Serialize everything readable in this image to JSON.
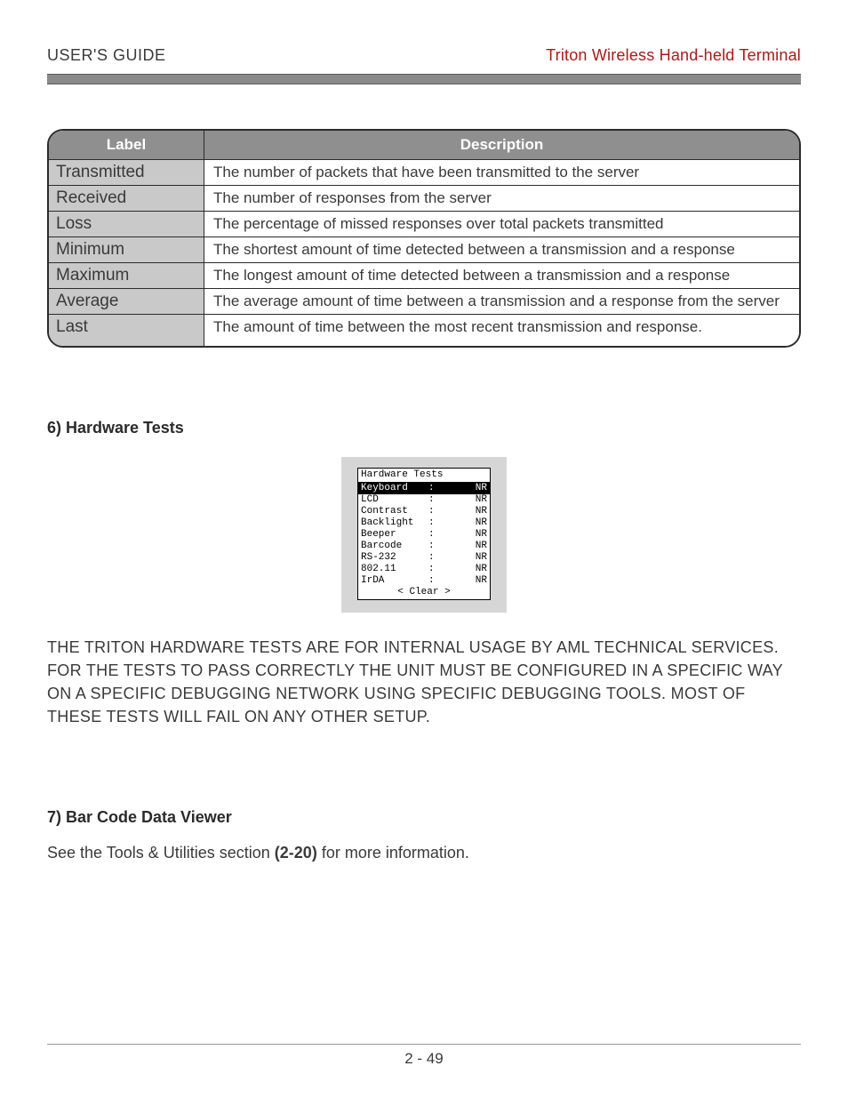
{
  "header": {
    "left": "USER'S GUIDE",
    "right": "Triton Wireless Hand-held Terminal"
  },
  "table": {
    "headers": {
      "label": "Label",
      "description": "Description"
    },
    "rows": [
      {
        "label": "Transmitted",
        "desc": "The number of packets that have been transmitted to the server"
      },
      {
        "label": "Received",
        "desc": "The number of responses from the server"
      },
      {
        "label": "Loss",
        "desc": "The percentage of missed responses over total packets transmitted"
      },
      {
        "label": "Minimum",
        "desc": "The shortest amount of time detected between a transmission and a response"
      },
      {
        "label": "Maximum",
        "desc": "The longest amount of time detected between a transmission and a response"
      },
      {
        "label": "Average",
        "desc": "The average amount of time between a transmission and a response from the server"
      },
      {
        "label": "Last",
        "desc": "The amount of time between the most recent transmission and response."
      }
    ]
  },
  "section6": {
    "heading": "6) Hardware Tests",
    "device": {
      "title": "Hardware Tests",
      "rows": [
        {
          "name": "Keyboard ",
          "sep": ":",
          "val": "NR",
          "selected": true
        },
        {
          "name": "LCD      ",
          "sep": ":",
          "val": "NR",
          "selected": false
        },
        {
          "name": "Contrast ",
          "sep": ":",
          "val": "NR",
          "selected": false
        },
        {
          "name": "Backlight",
          "sep": ":",
          "val": "NR",
          "selected": false
        },
        {
          "name": "Beeper   ",
          "sep": ":",
          "val": "NR",
          "selected": false
        },
        {
          "name": "Barcode  ",
          "sep": ":",
          "val": "NR",
          "selected": false
        },
        {
          "name": "RS-232   ",
          "sep": ":",
          "val": "NR",
          "selected": false
        },
        {
          "name": "802.11   ",
          "sep": ":",
          "val": "NR",
          "selected": false
        },
        {
          "name": "IrDA     ",
          "sep": ":",
          "val": "NR",
          "selected": false
        }
      ],
      "clear": "< Clear >"
    },
    "paragraph": "THE TRITON HARDWARE TESTS ARE FOR INTERNAL USAGE BY AML TECHNICAL SERVICES. FOR THE TESTS TO PASS CORRECTLY THE UNIT MUST BE CONFIGURED IN A SPECIFIC WAY ON A SPECIFIC DEBUGGING NETWORK USING SPECIFIC DEBUGGING TOOLS. MOST OF THESE TESTS WILL FAIL ON ANY OTHER SETUP."
  },
  "section7": {
    "heading": "7) Bar Code Data Viewer",
    "pre": "See the Tools & Utilities section ",
    "ref": "(2-20)",
    "post": " for more information."
  },
  "footer": {
    "page": "2 - 49"
  }
}
